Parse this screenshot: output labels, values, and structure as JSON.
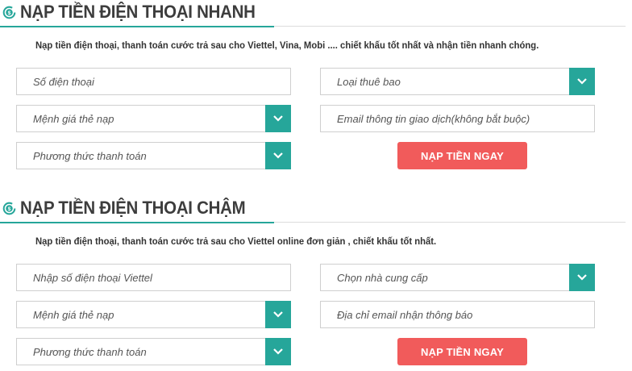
{
  "colors": {
    "accent": "#26a69a",
    "button": "#f15b5b"
  },
  "fast": {
    "title": "NẠP TIỀN ĐIỆN THOẠI NHANH",
    "description": "Nạp tiền điện thoại, thanh toán cước trả sau cho Viettel, Vina, Mobi .... chiết khấu tốt nhất và nhận tiền nhanh chóng.",
    "phone_placeholder": "Số điện thoại",
    "subscriber_type": "Loại thuê bao",
    "card_value": "Mệnh giá thẻ nạp",
    "email_placeholder": "Email thông tin giao dịch(không bắt buộc)",
    "payment_method": "Phương thức thanh toán",
    "submit_label": "NẠP TIỀN NGAY"
  },
  "slow": {
    "title": "NẠP TIỀN ĐIỆN THOẠI CHẬM",
    "description": "Nạp tiền điện thoại, thanh toán cước trả sau cho Viettel online đơn giản , chiết khấu tốt nhất.",
    "phone_placeholder": "Nhập số điện thoại Viettel",
    "provider": "Chọn nhà cung cấp",
    "card_value": "Mệnh giá thẻ nạp",
    "email_placeholder": "Địa chỉ email nhận thông báo",
    "payment_method": "Phương thức thanh toán",
    "submit_label": "NẠP TIỀN NGAY"
  }
}
